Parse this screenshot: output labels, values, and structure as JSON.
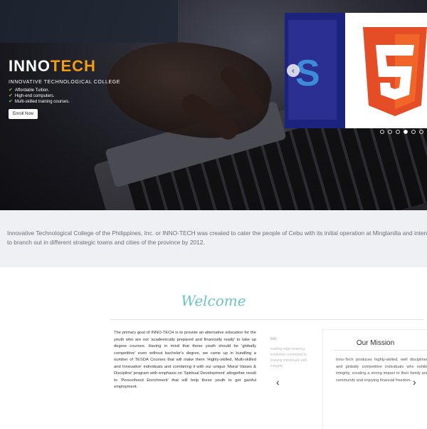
{
  "hero": {
    "brand_main": "INNO",
    "brand_accent": "TECH",
    "subtitle": "INNOVATIVE TECHNOLOGICAL COLLEGE",
    "features": [
      "Affordable Tuition.",
      "High-end computers.",
      "Multi-skilled training courses."
    ],
    "enroll_label": "Enroll Now",
    "slider_letter": "S",
    "html5_number": "5",
    "prev_symbol": "‹",
    "dots_count": 6,
    "active_dot_index": 3,
    "colors": {
      "accent": "#f39c12",
      "check": "#7ac943",
      "html5": "#e44d26"
    }
  },
  "intro": {
    "text": "Innovative Technological College of the Philippines, Inc. or INNO-TECH was created to cater the people of Cebu with its initial operation at Minglanilla and intends to branch out in different strategic towns and cities of the province by 2012."
  },
  "welcome": {
    "title": "Welcome",
    "goal_text": "The primary goal of INNO-TECH is to provide an alternative education for the youth who are not 'academically prepared and financially ready' to take up degree courses. Having in mind that these youth should be 'globally competitive' even without bachelor's degree, we came up in bundling a number of TESDA Courses that will make them 'Highly-skilled, Multi-skilled and Innovative' individuals and combining it with our unique 'Moral Values & Discipline' program with emphasis on 'Spiritual Development' altogether result to 'Personhood Enrichment' that will help these youth to get gainful employment.",
    "fade_head": "ion",
    "fade_text": "leading-edge learning institution committed to training individuals with integrity",
    "mission_title": "Our Mission",
    "mission_text": "Inno-Tech produces highly-skilled, well disciplined and globally competitive individuals who exhibit integrity, creating a strong impact to their family and community and enjoying financial freedom.",
    "left_arrow": "‹",
    "right_arrow": "›"
  }
}
